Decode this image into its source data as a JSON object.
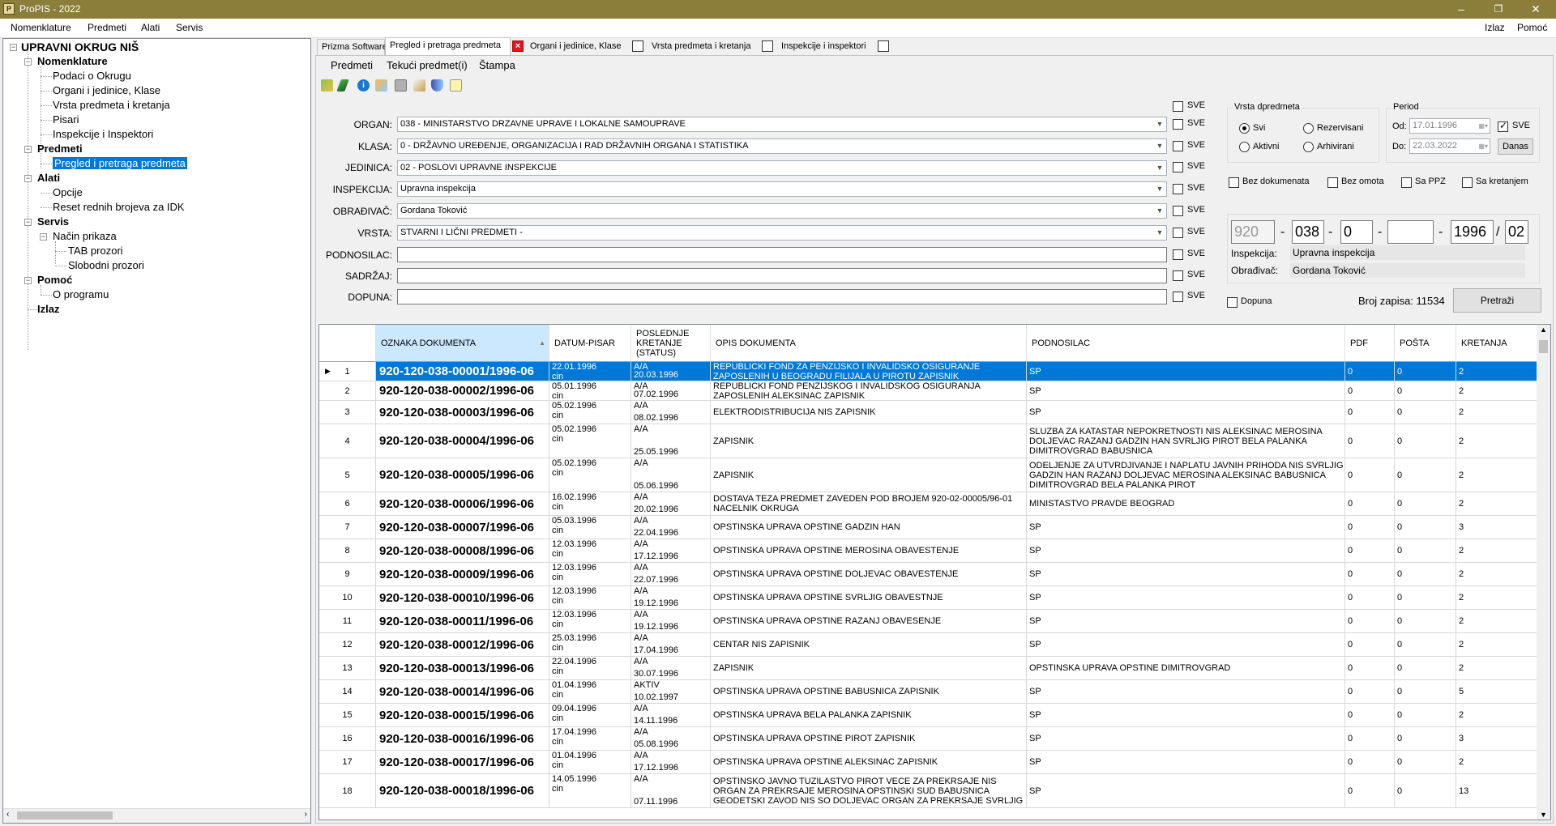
{
  "window": {
    "title": "ProPIS - 2022",
    "app_icon": "propis-app-icon"
  },
  "menubar": {
    "items": [
      "Nomenklature",
      "Predmeti",
      "Alati",
      "Servis"
    ],
    "right": [
      "Izlaz",
      "Pomoć"
    ]
  },
  "tree": {
    "root": "UPRAVNI OKRUG NIŠ",
    "nodes": [
      "Nomenklature",
      "Podaci o Okrugu",
      "Organi i jedinice, Klase",
      "Vrsta predmeta i kretanja",
      "Pisari",
      "Inspekcije i Inspektori",
      "Predmeti",
      "Pregled i pretraga predmeta",
      "Alati",
      "Opcije",
      "Reset rednih brojeva za IDK",
      "Servis",
      "Način prikaza",
      "TAB prozori",
      "Slobodni prozori",
      "Pomoć",
      "O programu",
      "Izlaz"
    ]
  },
  "tabs": [
    "Prizma Software",
    "Pregled i pretraga predmeta",
    "Organi i jedinice, Klase",
    "Vrsta predmeta i kretanja",
    "Inspekcije i inspektori"
  ],
  "submenu": [
    "Predmeti",
    "Tekući predmet(i)",
    "Štampa"
  ],
  "toolbar_icons": [
    "add-arrow-icon",
    "edit-pencil-icon",
    "info-icon",
    "search-people-icon",
    "save-disk-icon",
    "broom-icon",
    "shield-icon",
    "comment-icon"
  ],
  "filters": {
    "sve_label": "SVE",
    "organ": {
      "label": "ORGAN:",
      "value": "038   - MINISTARSTVO DRZAVNE UPRAVE I LOKALNE SAMOUPRAVE"
    },
    "klasa": {
      "label": "KLASA:",
      "value": "0      - DRŽAVNO UREĐENJE, ORGANIZACIJA I RAD DRŽAVNIH ORGANA I STATISTIKA"
    },
    "jedinica": {
      "label": "JEDINICA:",
      "value": "02    - POSLOVI UPRAVNE INSPEKCIJE"
    },
    "inspekcija": {
      "label": "INSPEKCIJA:",
      "value": "Upravna inspekcija"
    },
    "obradjivac": {
      "label": "OBRAĐIVAČ:",
      "value": "Gordana Toković"
    },
    "vrsta": {
      "label": "VRSTA:",
      "value": "STVARNI I LIČNI PREDMETI -"
    },
    "podnosilac": {
      "label": "PODNOSILAC:",
      "value": ""
    },
    "sadrzaj": {
      "label": "SADRŽAJ:",
      "value": ""
    },
    "dopuna": {
      "label": "DOPUNA:",
      "value": ""
    }
  },
  "vrsta_dpredmeta": {
    "title": "Vrsta dpredmeta",
    "options": [
      "Svi",
      "Rezervisani",
      "Aktivni",
      "Arhivirani"
    ],
    "selected": "Svi"
  },
  "period": {
    "title": "Period",
    "od_label": "Od:",
    "od_value": "17.01.1996",
    "do_label": "Do:",
    "do_value": "22.03.2022",
    "sve_label": "SVE",
    "sve_checked": true,
    "danas_label": "Danas"
  },
  "flags": [
    "Bez dokumenata",
    "Bez omota",
    "Sa PPZ",
    "Sa kretanjem"
  ],
  "number": {
    "p1": "920",
    "p2": "038",
    "p3": "0",
    "p4": "",
    "p5": "1996",
    "p6": "02",
    "sep": "-",
    "slash": "/"
  },
  "info": {
    "inspekcija_label": "Inspekcija:",
    "inspekcija_value": "Upravna inspekcija",
    "obradjivac_label": "Obrađivač:",
    "obradjivac_value": "Gordana Toković"
  },
  "search": {
    "dopuna_label": "Dopuna",
    "count_label": "Broj zapisa: 11534",
    "button": "Pretraži"
  },
  "grid": {
    "headers": [
      "OZNAKA DOKUMENTA",
      "DATUM-PISAR",
      "POSLEDNJE KRETANJE (STATUS)",
      "OPIS DOKUMENTA",
      "PODNOSILAC",
      "PDF",
      "POŠTA",
      "KRETANJA"
    ],
    "rows": [
      {
        "n": "1",
        "oznaka": "920-120-038-00001/1996-06",
        "datum": "22.01.1996",
        "pisar": "cin",
        "status": "A/A",
        "kdate": "20.03.1996",
        "opis": "REPUBLICKI FOND ZA PENZIJSKO I INVALIDSKO OSIGURANJE ZAPOSLENIH U BEOGRADU  FILIJALA U PIROTU ZAPISNIK",
        "podnosilac": "SP",
        "pdf": "0",
        "posta": "0",
        "kretanja": "2"
      },
      {
        "n": "2",
        "oznaka": "920-120-038-00002/1996-06",
        "datum": "05.01.1996",
        "pisar": "cin",
        "status": "A/A",
        "kdate": "07.02.1996",
        "opis": "REPUBLICKI FOND PENZIJSKOG I INVALIDSKOG OSIGURANJA ZAPOSLENIH ALEKSINAC ZAPISNIK",
        "podnosilac": "SP",
        "pdf": "0",
        "posta": "0",
        "kretanja": "2"
      },
      {
        "n": "3",
        "oznaka": "920-120-038-00003/1996-06",
        "datum": "05.02.1996",
        "pisar": "cin",
        "status": "A/A",
        "kdate": "08.02.1996",
        "opis": "ELEKTRODISTRIBUCIJA NIS ZAPISNIK",
        "podnosilac": "SP",
        "pdf": "0",
        "posta": "0",
        "kretanja": "2"
      },
      {
        "n": "4",
        "oznaka": "920-120-038-00004/1996-06",
        "datum": "05.02.1996",
        "pisar": "cin",
        "status": "A/A",
        "kdate": "25.05.1996",
        "opis": "ZAPISNIK",
        "podnosilac": "SLUZBA ZA KATASTAR NEPOKRETNOSTI NIS ALEKSINAC MEROSINA DOLJEVAC RAZANJ GADZIN HAN SVRLJIG PIROT BELA PALANKA DIMITROVGRAD BABUSNICA",
        "pdf": "0",
        "posta": "0",
        "kretanja": "2"
      },
      {
        "n": "5",
        "oznaka": "920-120-038-00005/1996-06",
        "datum": "05.02.1996",
        "pisar": "cin",
        "status": "A/A",
        "kdate": "05.06.1996",
        "opis": "ZAPISNIK",
        "podnosilac": "ODELJENJE ZA UTVRDJIVANJE I NAPLATU JAVNIH PRIHODA NIS SVRLJIG GADZIN HAN RAZANJ DOLJEVAC MEROSINA ALEKSINAC BABUSNICA DIMITROVGRAD BELA PALANKA PIROT",
        "pdf": "0",
        "posta": "0",
        "kretanja": "2"
      },
      {
        "n": "6",
        "oznaka": "920-120-038-00006/1996-06",
        "datum": "16.02.1996",
        "pisar": "cin",
        "status": "A/A",
        "kdate": "20.02.1996",
        "opis": "DOSTAVA TEZA PREDMET ZAVEDEN POD BROJEM 920-02-00005/96-01 NACELNIK OKRUGA",
        "podnosilac": "MINISTASTVO PRAVDE BEOGRAD",
        "pdf": "0",
        "posta": "0",
        "kretanja": "2"
      },
      {
        "n": "7",
        "oznaka": "920-120-038-00007/1996-06",
        "datum": "05.03.1996",
        "pisar": "cin",
        "status": "A/A",
        "kdate": "22.04.1996",
        "opis": "OPSTINSKA UPRAVA OPSTINE GADZIN HAN",
        "podnosilac": "SP",
        "pdf": "0",
        "posta": "0",
        "kretanja": "3"
      },
      {
        "n": "8",
        "oznaka": "920-120-038-00008/1996-06",
        "datum": "12.03.1996",
        "pisar": "cin",
        "status": "A/A",
        "kdate": "17.12.1996",
        "opis": "OPSTINSKA UPRAVA OPSTINE MEROSINA OBAVESTENJE",
        "podnosilac": "SP",
        "pdf": "0",
        "posta": "0",
        "kretanja": "2"
      },
      {
        "n": "9",
        "oznaka": "920-120-038-00009/1996-06",
        "datum": "12.03.1996",
        "pisar": "cin",
        "status": "A/A",
        "kdate": "22.07.1996",
        "opis": "OPSTINSKA UPRAVA OPSTINE DOLJEVAC OBAVESTENJE",
        "podnosilac": "SP",
        "pdf": "0",
        "posta": "0",
        "kretanja": "2"
      },
      {
        "n": "10",
        "oznaka": "920-120-038-00010/1996-06",
        "datum": "12.03.1996",
        "pisar": "cin",
        "status": "A/A",
        "kdate": "19.12.1996",
        "opis": "OPSTINSKA UPRAVA OPSTINE SVRLJIG OBAVESTNJE",
        "podnosilac": "SP",
        "pdf": "0",
        "posta": "0",
        "kretanja": "2"
      },
      {
        "n": "11",
        "oznaka": "920-120-038-00011/1996-06",
        "datum": "12.03.1996",
        "pisar": "cin",
        "status": "A/A",
        "kdate": "19.12.1996",
        "opis": "OPSTINSKA UPRAVA OPSTINE RAZANJ OBAVESENJE",
        "podnosilac": "SP",
        "pdf": "0",
        "posta": "0",
        "kretanja": "2"
      },
      {
        "n": "12",
        "oznaka": "920-120-038-00012/1996-06",
        "datum": "25.03.1996",
        "pisar": "cin",
        "status": "A/A",
        "kdate": "17.04.1996",
        "opis": "CENTAR NIS ZAPISNIK",
        "podnosilac": "SP",
        "pdf": "0",
        "posta": "0",
        "kretanja": "2"
      },
      {
        "n": "13",
        "oznaka": "920-120-038-00013/1996-06",
        "datum": "22.04.1996",
        "pisar": "cin",
        "status": "A/A",
        "kdate": "30.07.1996",
        "opis": "ZAPISNIK",
        "podnosilac": "OPSTINSKA UPRAVA OPSTINE DIMITROVGRAD",
        "pdf": "0",
        "posta": "0",
        "kretanja": "2"
      },
      {
        "n": "14",
        "oznaka": "920-120-038-00014/1996-06",
        "datum": "01.04.1996",
        "pisar": "cin",
        "status": "AKTIV",
        "kdate": "10.02.1997",
        "opis": "OPSTINSKA UPRAVA OPSTINE BABUSNICA ZAPISNIK",
        "podnosilac": "SP",
        "pdf": "0",
        "posta": "0",
        "kretanja": "5"
      },
      {
        "n": "15",
        "oznaka": "920-120-038-00015/1996-06",
        "datum": "09.04.1996",
        "pisar": "cin",
        "status": "A/A",
        "kdate": "14.11.1996",
        "opis": "OPSTINSKA UPRAVA BELA PALANKA ZAPISNIK",
        "podnosilac": "SP",
        "pdf": "0",
        "posta": "0",
        "kretanja": "2"
      },
      {
        "n": "16",
        "oznaka": "920-120-038-00016/1996-06",
        "datum": "17.04.1996",
        "pisar": "cin",
        "status": "A/A",
        "kdate": "05.08.1996",
        "opis": "OPSTINSKA UPRAVA OPSTINE PIROT ZAPISNIK",
        "podnosilac": "SP",
        "pdf": "0",
        "posta": "0",
        "kretanja": "3"
      },
      {
        "n": "17",
        "oznaka": "920-120-038-00017/1996-06",
        "datum": "01.04.1996",
        "pisar": "cin",
        "status": "A/A",
        "kdate": "17.12.1996",
        "opis": "OPSTINSKA UPRAVA OPSTINE ALEKSINAC ZAPISNIK",
        "podnosilac": "SP",
        "pdf": "0",
        "posta": "0",
        "kretanja": "2"
      },
      {
        "n": "18",
        "oznaka": "920-120-038-00018/1996-06",
        "datum": "14.05.1996",
        "pisar": "cin",
        "status": "A/A",
        "kdate": "07.11.1996",
        "opis": "OPSTINSKO JAVNO TUZILASTVO PIROT VECE ZA PREKRSAJE NIS ORGAN ZA PREKRSAJE MEROSINA OPSTINSKI SUD BABUSNICA GEODETSKI ZAVOD NIS SO DOLJEVAC ORGAN ZA PREKRSAJE SVRLJIG",
        "podnosilac": "SP",
        "pdf": "0",
        "posta": "0",
        "kretanja": "13"
      }
    ]
  }
}
